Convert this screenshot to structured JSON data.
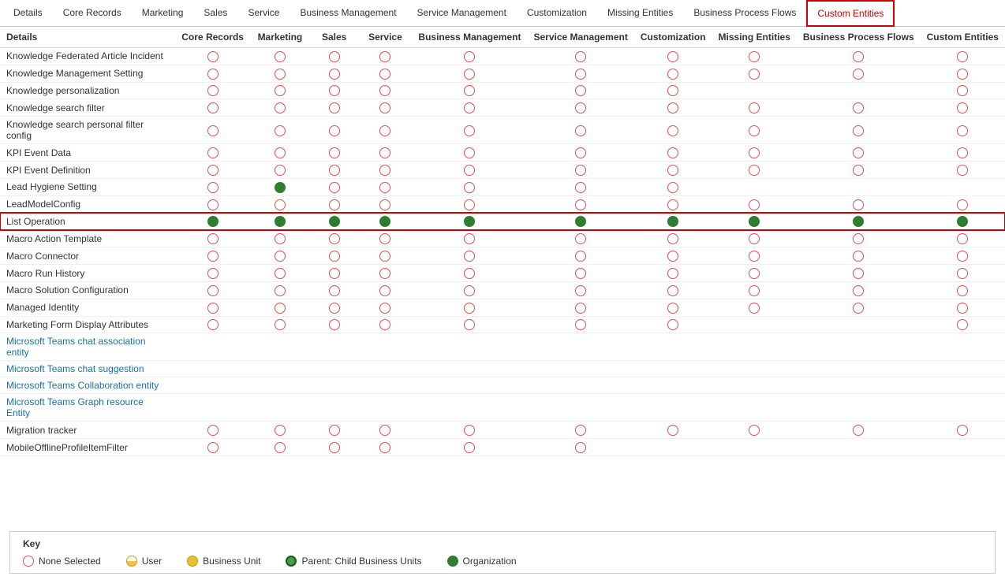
{
  "tabs": [
    {
      "id": "details",
      "label": "Details",
      "active": false
    },
    {
      "id": "core-records",
      "label": "Core Records",
      "active": false
    },
    {
      "id": "marketing",
      "label": "Marketing",
      "active": false
    },
    {
      "id": "sales",
      "label": "Sales",
      "active": false
    },
    {
      "id": "service",
      "label": "Service",
      "active": false
    },
    {
      "id": "business-mgmt",
      "label": "Business Management",
      "active": false
    },
    {
      "id": "service-mgmt",
      "label": "Service Management",
      "active": false
    },
    {
      "id": "customization",
      "label": "Customization",
      "active": false
    },
    {
      "id": "missing-entities",
      "label": "Missing Entities",
      "active": false
    },
    {
      "id": "business-process-flows",
      "label": "Business Process Flows",
      "active": false
    },
    {
      "id": "custom-entities",
      "label": "Custom Entities",
      "active": true
    }
  ],
  "columns": [
    {
      "id": "name",
      "label": ""
    },
    {
      "id": "core-records",
      "label": "Core Records"
    },
    {
      "id": "marketing",
      "label": "Marketing"
    },
    {
      "id": "sales",
      "label": "Sales"
    },
    {
      "id": "service",
      "label": "Service"
    },
    {
      "id": "business-mgmt",
      "label": "Business Management"
    },
    {
      "id": "service-mgmt",
      "label": "Service Management"
    },
    {
      "id": "customization",
      "label": "Customization"
    },
    {
      "id": "missing-entities",
      "label": "Missing Entities"
    },
    {
      "id": "business-process-flows",
      "label": "Business Process Flows"
    },
    {
      "id": "custom-entities",
      "label": "Custom Entities"
    }
  ],
  "rows": [
    {
      "name": "Knowledge Federated Article Incident",
      "link": false,
      "highlighted": false,
      "values": [
        "empty",
        "empty",
        "empty",
        "empty",
        "empty",
        "empty",
        "empty",
        "empty",
        "empty",
        "empty"
      ]
    },
    {
      "name": "Knowledge Management Setting",
      "link": false,
      "highlighted": false,
      "values": [
        "empty",
        "empty",
        "empty",
        "empty",
        "empty",
        "empty",
        "empty",
        "empty",
        "empty",
        "empty"
      ]
    },
    {
      "name": "Knowledge personalization",
      "link": false,
      "highlighted": false,
      "values": [
        "empty",
        "empty",
        "empty",
        "empty",
        "empty",
        "empty",
        "empty",
        null,
        null,
        "empty"
      ]
    },
    {
      "name": "Knowledge search filter",
      "link": false,
      "highlighted": false,
      "values": [
        "empty",
        "empty",
        "empty",
        "empty",
        "empty",
        "empty",
        "empty",
        "empty",
        "empty",
        "empty"
      ]
    },
    {
      "name": "Knowledge search personal filter config",
      "link": false,
      "highlighted": false,
      "values": [
        "empty",
        "empty",
        "empty",
        "empty",
        "empty",
        "empty",
        "empty",
        "empty",
        "empty",
        "empty"
      ]
    },
    {
      "name": "KPI Event Data",
      "link": false,
      "highlighted": false,
      "values": [
        "empty",
        "empty",
        "empty",
        "empty",
        "empty",
        "empty",
        "empty",
        "empty",
        "empty",
        "empty"
      ]
    },
    {
      "name": "KPI Event Definition",
      "link": false,
      "highlighted": false,
      "values": [
        "empty",
        "empty",
        "empty",
        "empty",
        "empty",
        "empty",
        "empty",
        "empty",
        "empty",
        "empty"
      ]
    },
    {
      "name": "Lead Hygiene Setting",
      "link": false,
      "highlighted": false,
      "values": [
        "empty",
        "green",
        "empty",
        "empty",
        "empty",
        "empty",
        "empty",
        null,
        null,
        null
      ]
    },
    {
      "name": "LeadModelConfig",
      "link": false,
      "highlighted": false,
      "values": [
        "empty",
        "empty",
        "empty",
        "empty",
        "empty",
        "empty",
        "empty",
        "empty",
        "empty",
        "empty"
      ]
    },
    {
      "name": "List Operation",
      "link": false,
      "highlighted": true,
      "values": [
        "green",
        "green",
        "green",
        "green",
        "green",
        "green",
        "green",
        "green",
        "green",
        "green"
      ]
    },
    {
      "name": "Macro Action Template",
      "link": false,
      "highlighted": false,
      "values": [
        "empty",
        "empty",
        "empty",
        "empty",
        "empty",
        "empty",
        "empty",
        "empty",
        "empty",
        "empty"
      ]
    },
    {
      "name": "Macro Connector",
      "link": false,
      "highlighted": false,
      "values": [
        "empty",
        "empty",
        "empty",
        "empty",
        "empty",
        "empty",
        "empty",
        "empty",
        "empty",
        "empty"
      ]
    },
    {
      "name": "Macro Run History",
      "link": false,
      "highlighted": false,
      "values": [
        "empty",
        "empty",
        "empty",
        "empty",
        "empty",
        "empty",
        "empty",
        "empty",
        "empty",
        "empty"
      ]
    },
    {
      "name": "Macro Solution Configuration",
      "link": false,
      "highlighted": false,
      "values": [
        "empty",
        "empty",
        "empty",
        "empty",
        "empty",
        "empty",
        "empty",
        "empty",
        "empty",
        "empty"
      ]
    },
    {
      "name": "Managed Identity",
      "link": false,
      "highlighted": false,
      "values": [
        "empty",
        "empty",
        "empty",
        "empty",
        "empty",
        "empty",
        "empty",
        "empty",
        "empty",
        "empty"
      ]
    },
    {
      "name": "Marketing Form Display Attributes",
      "link": false,
      "highlighted": false,
      "values": [
        "empty",
        "empty",
        "empty",
        "empty",
        "empty",
        "empty",
        "empty",
        null,
        null,
        "empty"
      ]
    },
    {
      "name": "Microsoft Teams chat association entity",
      "link": true,
      "highlighted": false,
      "values": [
        null,
        null,
        null,
        null,
        null,
        null,
        null,
        null,
        null,
        null
      ]
    },
    {
      "name": "Microsoft Teams chat suggestion",
      "link": true,
      "highlighted": false,
      "values": [
        null,
        null,
        null,
        null,
        null,
        null,
        null,
        null,
        null,
        null
      ]
    },
    {
      "name": "Microsoft Teams Collaboration entity",
      "link": true,
      "highlighted": false,
      "values": [
        null,
        null,
        null,
        null,
        null,
        null,
        null,
        null,
        null,
        null
      ]
    },
    {
      "name": "Microsoft Teams Graph resource Entity",
      "link": true,
      "highlighted": false,
      "values": [
        null,
        null,
        null,
        null,
        null,
        null,
        null,
        null,
        null,
        null
      ]
    },
    {
      "name": "Migration tracker",
      "link": false,
      "highlighted": false,
      "values": [
        "empty",
        "empty",
        "empty",
        "empty",
        "empty",
        "empty",
        "empty",
        "empty",
        "empty",
        "empty"
      ]
    },
    {
      "name": "MobileOfflineProfileItemFilter",
      "link": false,
      "highlighted": false,
      "values": [
        "empty",
        "empty",
        "empty",
        "empty",
        "empty",
        "empty",
        null,
        null,
        null,
        null
      ]
    }
  ],
  "key": {
    "title": "Key",
    "items": [
      {
        "id": "none",
        "label": "None Selected",
        "type": "empty"
      },
      {
        "id": "user",
        "label": "User",
        "type": "user"
      },
      {
        "id": "bu",
        "label": "Business Unit",
        "type": "bu"
      },
      {
        "id": "parent",
        "label": "Parent: Child Business Units",
        "type": "parent"
      },
      {
        "id": "org",
        "label": "Organization",
        "type": "org"
      }
    ]
  }
}
